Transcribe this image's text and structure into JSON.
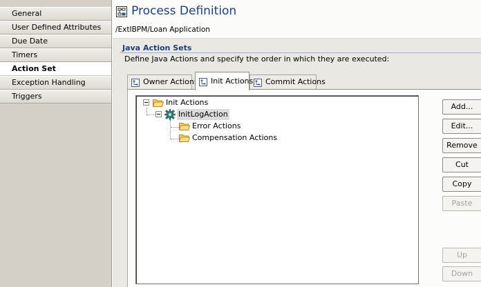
{
  "sidebar": {
    "items": [
      {
        "label": "General",
        "active": false
      },
      {
        "label": "User Defined Attributes",
        "active": false
      },
      {
        "label": "Due Date",
        "active": false
      },
      {
        "label": "Timers",
        "active": false
      },
      {
        "label": "Action Set",
        "active": true
      },
      {
        "label": "Exception Handling",
        "active": false
      },
      {
        "label": "Triggers",
        "active": false
      }
    ]
  },
  "header": {
    "title": "Process Definition",
    "title_icon": "process-definition-icon",
    "path": "/ExtIBPM/Loan Application"
  },
  "section": {
    "title": "Java Action Sets",
    "description": "Define Java Actions and specify the order in which they are executed:"
  },
  "tabs": [
    {
      "label": "Owner Actions",
      "icon": "action-set-icon",
      "active": false
    },
    {
      "label": "Init Actions",
      "icon": "action-set-icon",
      "active": true
    },
    {
      "label": "Commit Actions",
      "icon": "action-set-icon",
      "active": false
    }
  ],
  "tree": {
    "root": {
      "label": "Init Actions",
      "icon": "folder-open-icon",
      "expanded": true
    },
    "action": {
      "label": "InitLogAction",
      "icon": "gear-icon",
      "expanded": true,
      "selected": true
    },
    "children": [
      {
        "label": "Error Actions",
        "icon": "folder-open-icon"
      },
      {
        "label": "Compensation Actions",
        "icon": "folder-open-icon"
      }
    ]
  },
  "buttons": {
    "add": "Add...",
    "edit": "Edit...",
    "remove": "Remove",
    "cut": "Cut",
    "copy": "Copy",
    "paste": "Paste",
    "up": "Up",
    "down": "Down"
  },
  "colors": {
    "title": "#1f3f7d",
    "section_title": "#213e7b",
    "sidebar_bg": "#d4d0c8",
    "panel_bg": "#e9e8e2",
    "folder": "#e8b53e"
  }
}
